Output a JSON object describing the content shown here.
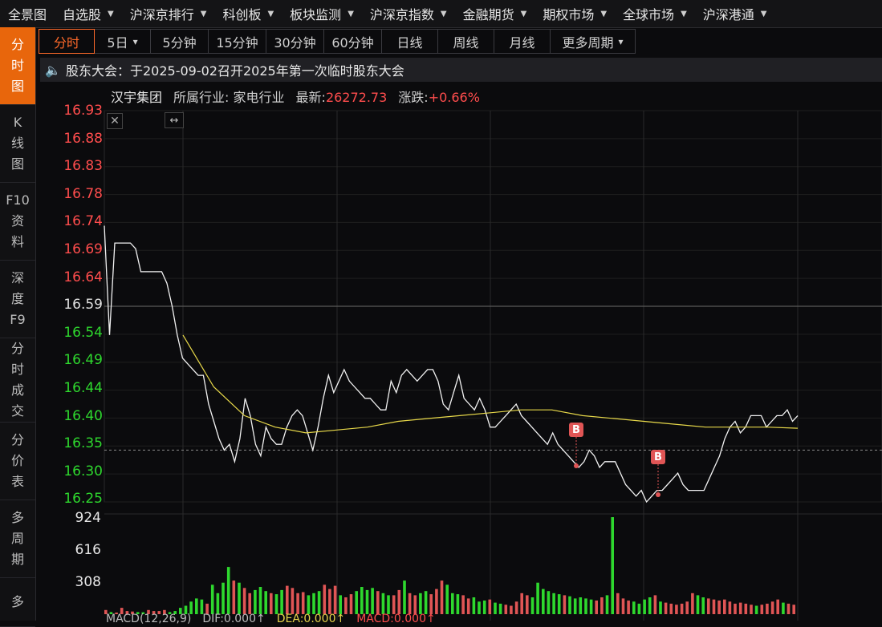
{
  "topnav": [
    {
      "label": "全景图",
      "caret": false
    },
    {
      "label": "自选股",
      "caret": true
    },
    {
      "label": "沪深京排行",
      "caret": true
    },
    {
      "label": "科创板",
      "caret": true
    },
    {
      "label": "板块监测",
      "caret": true
    },
    {
      "label": "沪深京指数",
      "caret": true
    },
    {
      "label": "金融期货",
      "caret": true
    },
    {
      "label": "期权市场",
      "caret": true
    },
    {
      "label": "全球市场",
      "caret": true
    },
    {
      "label": "沪深港通",
      "caret": true
    }
  ],
  "sidebar": [
    {
      "label": "分\n时\n图",
      "active": true
    },
    {
      "label": "K\n线\n图",
      "active": false
    },
    {
      "label": "F10\n资\n料",
      "active": false
    },
    {
      "label": "深\n度\nF9",
      "active": false
    },
    {
      "label": "分\n时\n成\n交",
      "active": false
    },
    {
      "label": "分\n价\n表",
      "active": false
    },
    {
      "label": "多\n周\n期",
      "active": false
    },
    {
      "label": "多",
      "active": false
    }
  ],
  "tabs": [
    {
      "label": "分时",
      "active": true
    },
    {
      "label": "5日",
      "caret": true
    },
    {
      "label": "5分钟"
    },
    {
      "label": "15分钟"
    },
    {
      "label": "30分钟"
    },
    {
      "label": "60分钟"
    },
    {
      "label": "日线"
    },
    {
      "label": "周线"
    },
    {
      "label": "月线"
    },
    {
      "label": "更多周期",
      "caret": true
    }
  ],
  "notice": {
    "text": "股东大会：于2025-09-02召开2025年第一次临时股东大会",
    "icon": "speaker-icon"
  },
  "stock": {
    "name": "汉宇集团",
    "industry_label": "所属行业:",
    "industry": "家电行业",
    "latest_label": "最新:",
    "latest": "26272.73",
    "change_label": "涨跌:",
    "change": "+0.66%"
  },
  "price_axis": {
    "labels": [
      "16.93",
      "16.88",
      "16.83",
      "16.78",
      "16.74",
      "16.69",
      "16.64",
      "16.59",
      "16.54",
      "16.49",
      "16.44",
      "16.40",
      "16.35",
      "16.30",
      "16.25"
    ],
    "ref_index": 7,
    "colors": {
      "up": "#ff4d4d",
      "ref": "#e0e0e0",
      "down": "#2ed82e"
    }
  },
  "volume_axis": {
    "labels": [
      "924",
      "616",
      "308"
    ]
  },
  "markers": [
    {
      "label": "B"
    },
    {
      "label": "B"
    }
  ],
  "chart_data": {
    "type": "line",
    "ylim": [
      16.25,
      16.93
    ],
    "ref_price": 16.59,
    "last_price": 16.34,
    "series": [
      {
        "values": [
          16.73,
          16.54,
          16.7,
          16.7,
          16.7,
          16.7,
          16.69,
          16.65,
          16.65,
          16.65,
          16.65,
          16.65,
          16.63,
          16.59,
          16.54,
          16.5,
          16.49,
          16.48,
          16.47,
          16.47,
          16.42,
          16.39,
          16.36,
          16.34,
          16.35,
          16.32,
          16.36,
          16.43,
          16.4,
          16.35,
          16.33,
          16.38,
          16.36,
          16.35,
          16.35,
          16.38,
          16.4,
          16.41,
          16.4,
          16.37,
          16.34,
          16.38,
          16.43,
          16.47,
          16.44,
          16.46,
          16.48,
          16.46,
          16.45,
          16.44,
          16.43,
          16.43,
          16.42,
          16.41,
          16.41,
          16.46,
          16.44,
          16.47,
          16.48,
          16.47,
          16.46,
          16.47,
          16.48,
          16.48,
          16.46,
          16.42,
          16.41,
          16.44,
          16.47,
          16.43,
          16.42,
          16.41,
          16.43,
          16.41,
          16.38,
          16.38,
          16.39,
          16.4,
          16.41,
          16.42,
          16.4,
          16.39,
          16.38,
          16.37,
          16.36,
          16.35,
          16.37,
          16.35,
          16.34,
          16.33,
          16.32,
          16.31,
          16.32,
          16.34,
          16.33,
          16.31,
          16.32,
          16.32,
          16.32,
          16.3,
          16.28,
          16.27,
          16.26,
          16.27,
          16.25,
          16.26,
          16.27,
          16.27,
          16.28,
          16.29,
          16.3,
          16.28,
          16.27,
          16.27,
          16.27,
          16.27,
          16.29,
          16.31,
          16.33,
          16.36,
          16.38,
          16.39,
          16.37,
          16.38,
          16.4,
          16.4,
          16.4,
          16.38,
          16.39,
          16.4,
          16.4,
          16.41,
          16.39,
          16.4
        ]
      },
      {
        "values": [
          16.54,
          16.45,
          16.4,
          16.38,
          16.37,
          16.375,
          16.38,
          16.39,
          16.395,
          16.4,
          16.405,
          16.41,
          16.41,
          16.4,
          16.395,
          16.39,
          16.385,
          16.38,
          16.38,
          16.38,
          16.378
        ]
      }
    ],
    "volume": [
      40,
      20,
      15,
      60,
      30,
      25,
      20,
      18,
      40,
      30,
      30,
      40,
      20,
      30,
      60,
      80,
      120,
      150,
      140,
      100,
      280,
      200,
      300,
      450,
      320,
      300,
      250,
      200,
      230,
      260,
      220,
      200,
      190,
      230,
      270,
      250,
      200,
      210,
      180,
      200,
      220,
      280,
      240,
      270,
      180,
      160,
      190,
      220,
      260,
      230,
      250,
      220,
      200,
      180,
      180,
      230,
      320,
      200,
      180,
      200,
      220,
      190,
      240,
      320,
      280,
      200,
      190,
      180,
      150,
      160,
      120,
      130,
      140,
      110,
      100,
      90,
      80,
      120,
      200,
      180,
      160,
      300,
      240,
      220,
      200,
      190,
      180,
      170,
      150,
      160,
      150,
      140,
      130,
      160,
      180,
      924,
      200,
      150,
      130,
      120,
      100,
      140,
      160,
      180,
      120,
      110,
      100,
      90,
      100,
      120,
      200,
      180,
      160,
      150,
      140,
      130,
      140,
      120,
      100,
      110,
      100,
      90,
      80,
      90,
      100,
      120,
      140,
      110,
      100,
      90
    ]
  },
  "macd": {
    "title": "MACD(12,26,9)",
    "dif": "DIF:0.000↑",
    "dea": "DEA:0.000↑",
    "macd": "MACD:0.000↑"
  }
}
